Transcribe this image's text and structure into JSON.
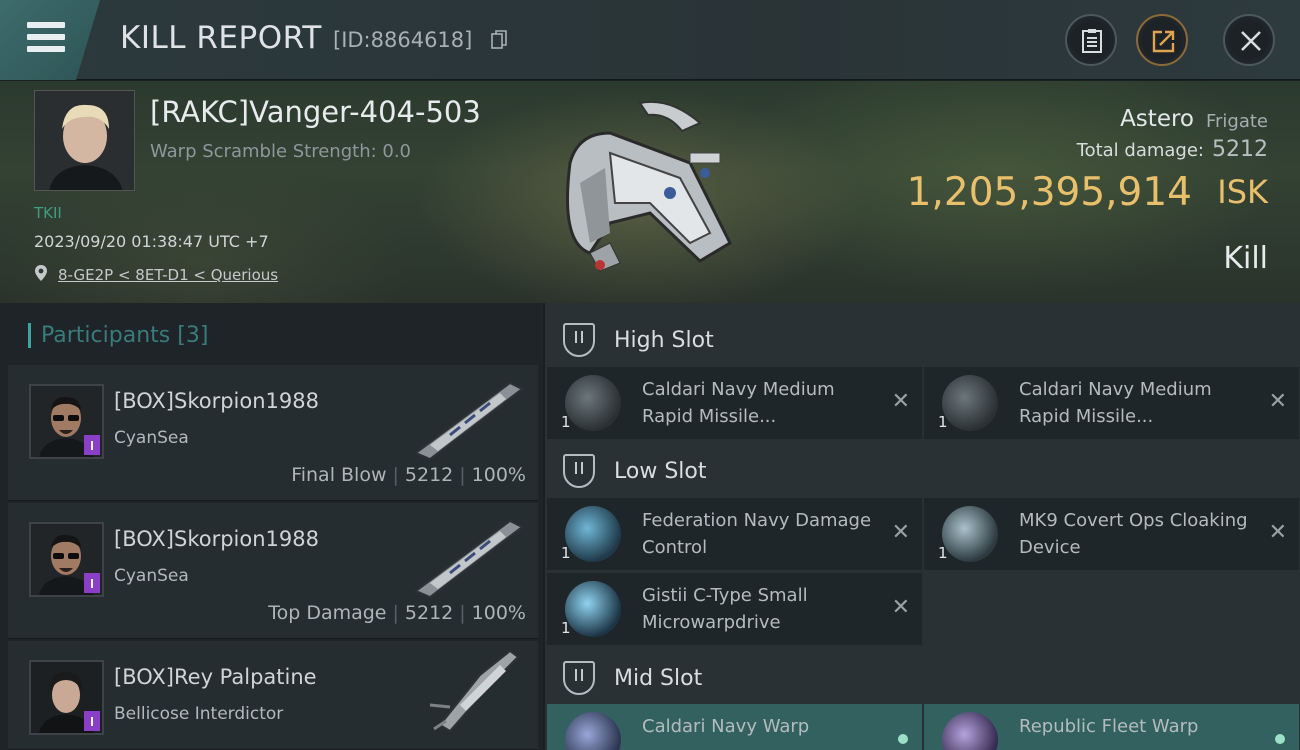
{
  "header": {
    "title": "KILL REPORT",
    "kill_id": "[ID:8864618]"
  },
  "victim": {
    "name": "[RAKC]Vanger-404-503",
    "warp_scramble": "Warp Scramble Strength: 0.0",
    "corp_tag": "TKII",
    "timestamp": "2023/09/20 01:38:47 UTC +7",
    "location": "8-GE2P < 8ET-D1 < Querious",
    "ship_name": "Astero",
    "ship_class": "Frigate",
    "total_damage_label": "Total damage:",
    "total_damage": "5212",
    "isk_value": "1,205,395,914",
    "isk_unit": "ISK",
    "result": "Kill"
  },
  "participants": {
    "label": "Participants",
    "count": "[3]",
    "rows": [
      {
        "name": "[BOX]Skorpion1988",
        "ship": "CyanSea",
        "role": "Final Blow",
        "damage": "5212",
        "percent": "100%"
      },
      {
        "name": "[BOX]Skorpion1988",
        "ship": "CyanSea",
        "role": "Top Damage",
        "damage": "5212",
        "percent": "100%"
      },
      {
        "name": "[BOX]Rey Palpatine",
        "ship": "Bellicose Interdictor"
      }
    ]
  },
  "fitting": {
    "high_slot": {
      "title": "High Slot",
      "modules": [
        {
          "qty": "1",
          "name": "Caldari Navy Medium Rapid Missile..."
        },
        {
          "qty": "1",
          "name": "Caldari Navy Medium Rapid Missile..."
        }
      ]
    },
    "low_slot": {
      "title": "Low Slot",
      "modules": [
        {
          "qty": "1",
          "name": "Federation Navy Damage Control"
        },
        {
          "qty": "1",
          "name": "MK9 Covert Ops Cloaking Device"
        },
        {
          "qty": "1",
          "name": "Gistii C-Type Small Microwarpdrive"
        }
      ]
    },
    "mid_slot": {
      "title": "Mid Slot",
      "modules": [
        {
          "name": "Caldari Navy Warp"
        },
        {
          "name": "Republic Fleet Warp"
        }
      ]
    },
    "destroyed_mark": "✕"
  }
}
